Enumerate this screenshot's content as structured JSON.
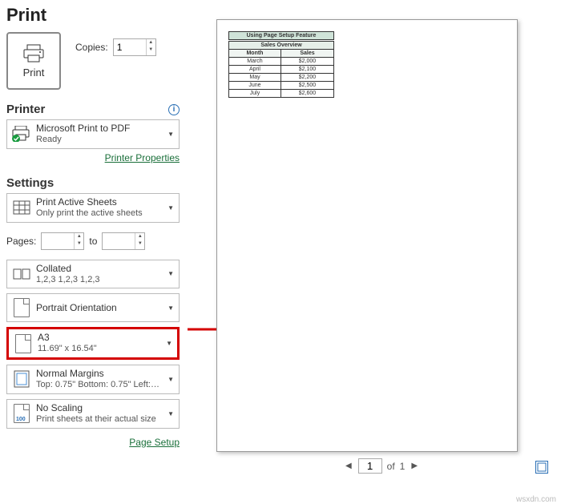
{
  "title": "Print",
  "print_button": {
    "label": "Print"
  },
  "copies": {
    "label": "Copies:",
    "value": "1"
  },
  "printer": {
    "heading": "Printer",
    "name": "Microsoft Print to PDF",
    "status": "Ready",
    "properties_link": "Printer Properties"
  },
  "settings": {
    "heading": "Settings",
    "scope": {
      "main": "Print Active Sheets",
      "sub": "Only print the active sheets"
    },
    "pages": {
      "label": "Pages:",
      "to": "to",
      "from": "",
      "until": ""
    },
    "collate": {
      "main": "Collated",
      "sub": "1,2,3    1,2,3    1,2,3"
    },
    "orientation": {
      "main": "Portrait Orientation"
    },
    "paper": {
      "main": "A3",
      "sub": "11.69\" x 16.54\""
    },
    "margins": {
      "main": "Normal Margins",
      "sub": "Top: 0.75\" Bottom: 0.75\" Left:…"
    },
    "scaling": {
      "main": "No Scaling",
      "sub": "Print sheets at their actual size",
      "iconnum": "100"
    },
    "page_setup_link": "Page Setup"
  },
  "preview": {
    "table": {
      "title": "Using Page Setup Feature",
      "subtitle": "Sales Overview",
      "headers": [
        "Month",
        "Sales"
      ],
      "rows": [
        [
          "March",
          "$2,000"
        ],
        [
          "April",
          "$2,100"
        ],
        [
          "May",
          "$2,200"
        ],
        [
          "June",
          "$2,500"
        ],
        [
          "July",
          "$2,600"
        ]
      ]
    }
  },
  "pager": {
    "current": "1",
    "of_label": "of",
    "total": "1"
  },
  "watermark": "wsxdn.com"
}
